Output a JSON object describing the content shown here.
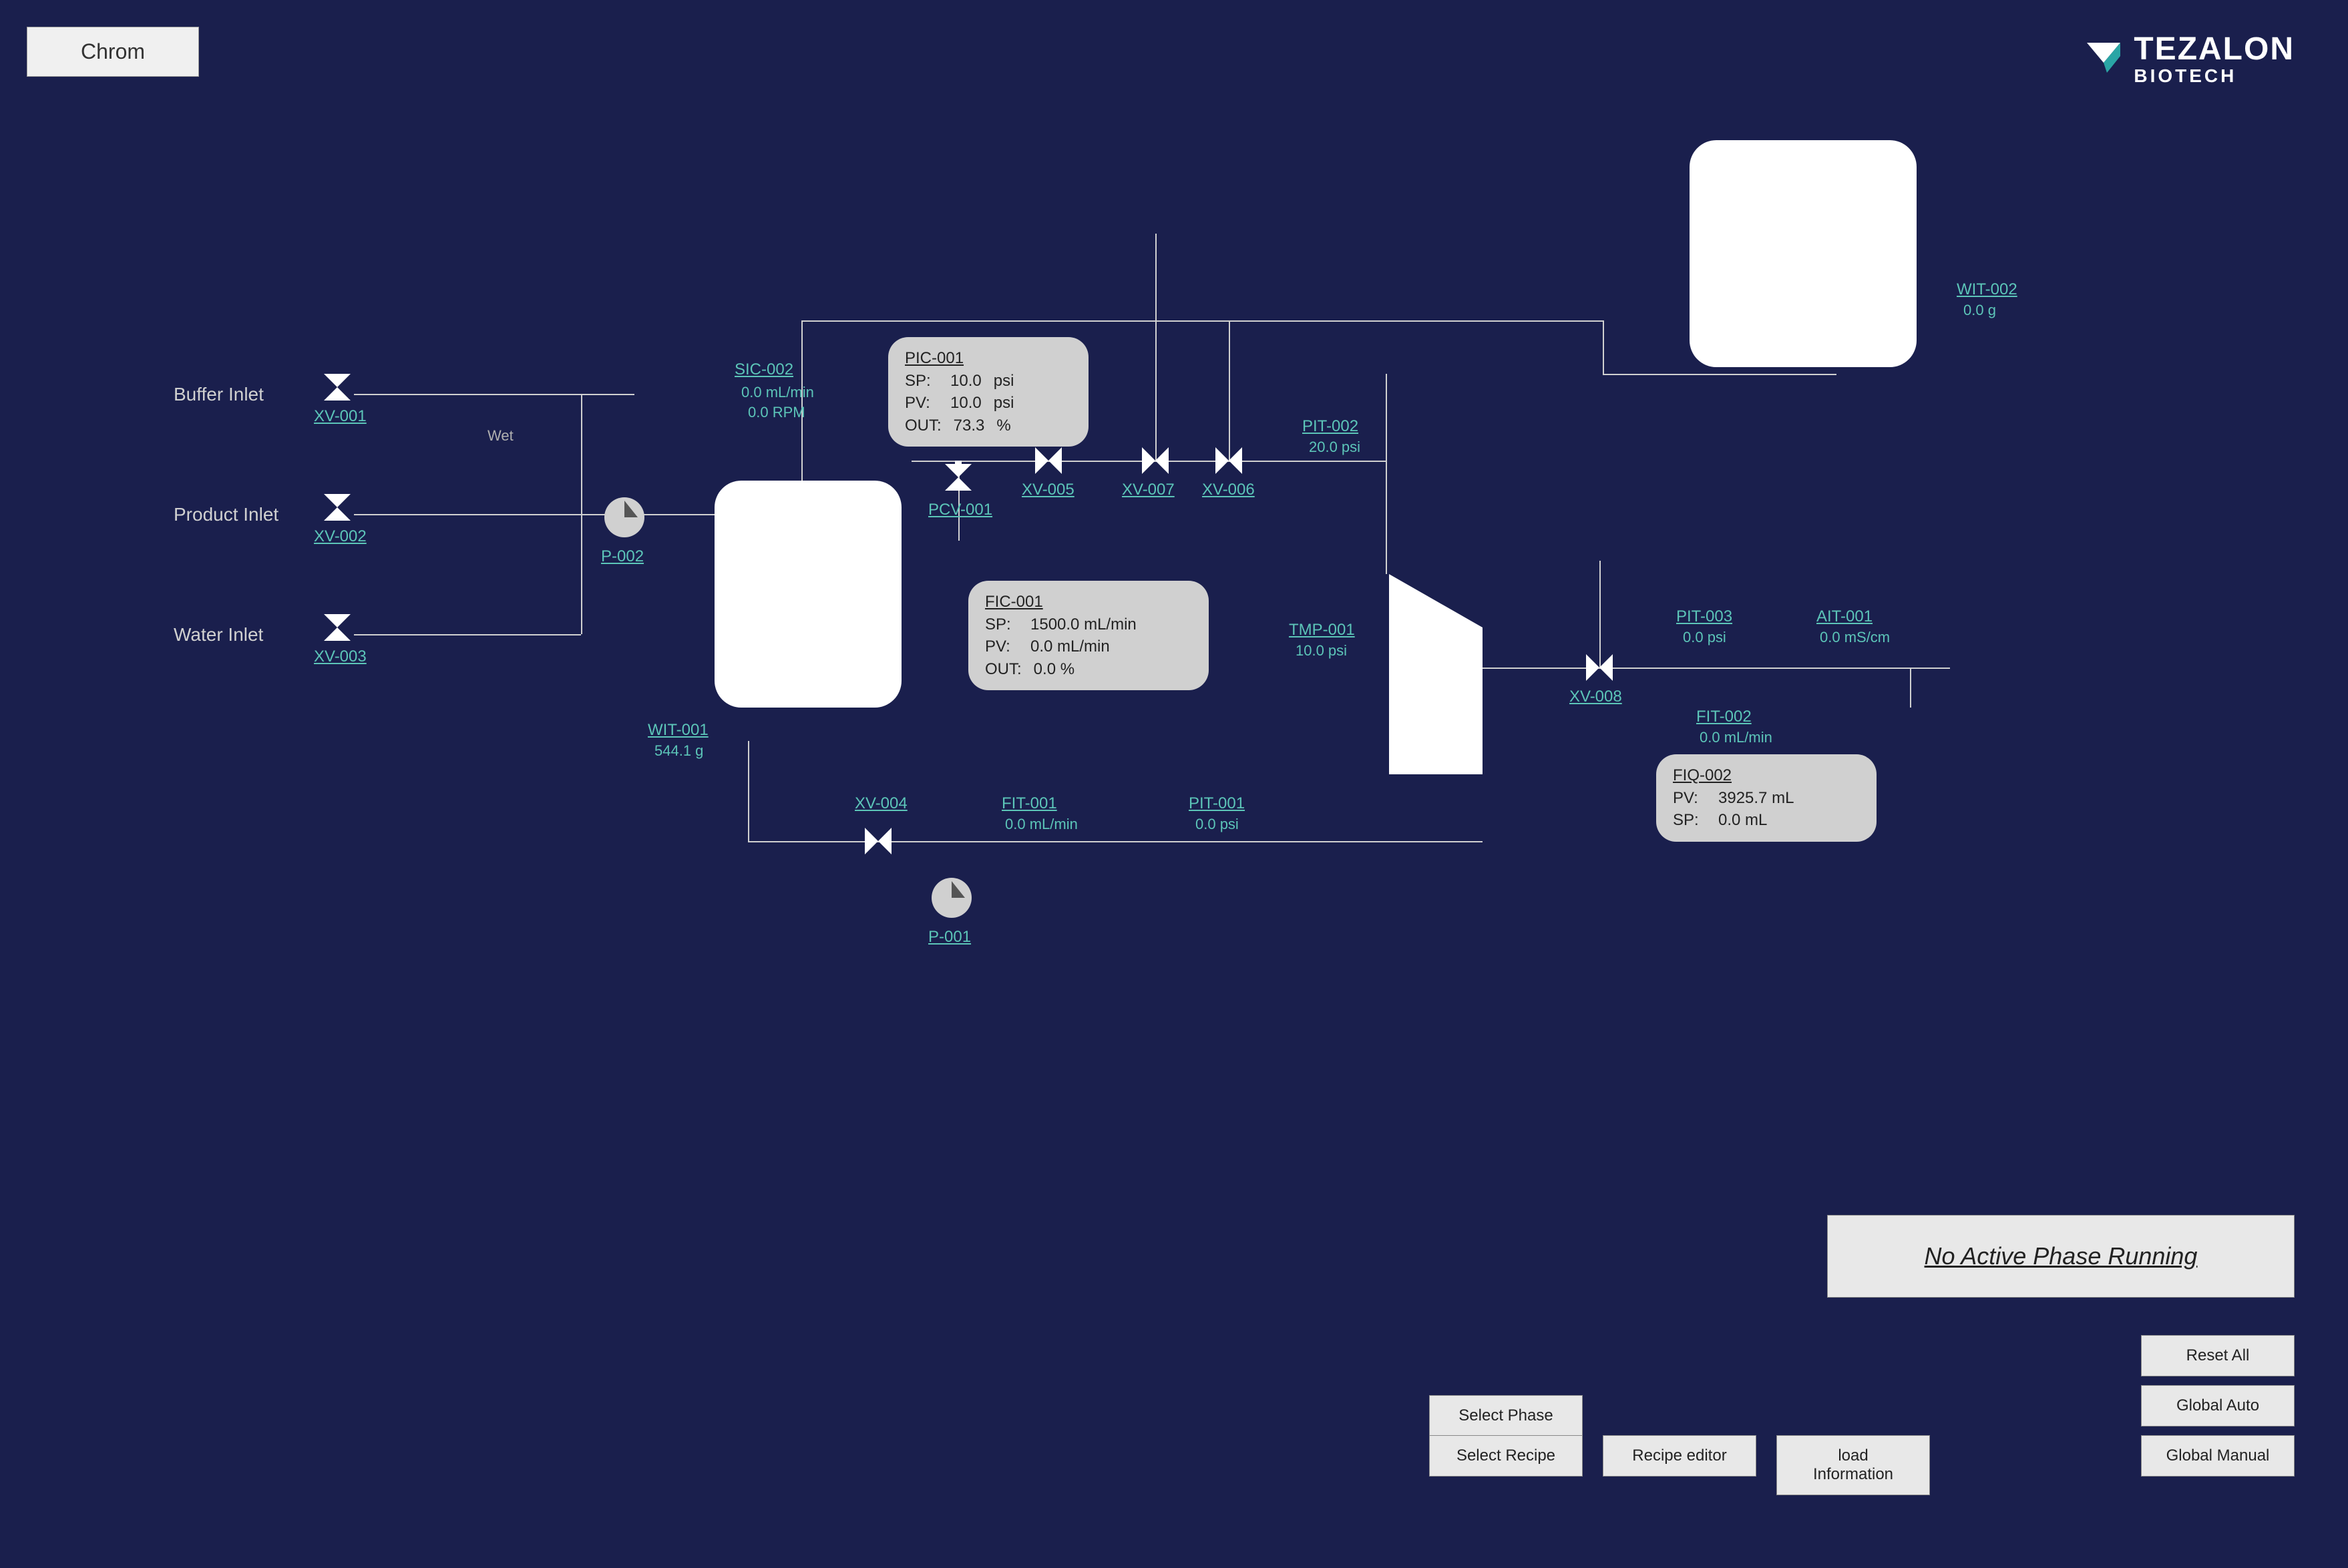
{
  "tab": "Chrom",
  "brand": {
    "name": "TEZALON",
    "sub": "BIOTECH"
  },
  "inlets": {
    "buffer": {
      "label": "Buffer Inlet",
      "valve": "XV-001"
    },
    "product": {
      "label": "Product Inlet",
      "valve": "XV-002"
    },
    "water": {
      "label": "Water Inlet",
      "valve": "XV-003"
    },
    "wet": "Wet"
  },
  "pumps": {
    "p002": "P-002",
    "p001": "P-001"
  },
  "sic002": {
    "tag": "SIC-002",
    "flow": "0.0 mL/min",
    "rpm": "0.0 RPM"
  },
  "wit001": {
    "tag": "WIT-001",
    "value": "544.1 g"
  },
  "wit002": {
    "tag": "WIT-002",
    "value": "0.0 g"
  },
  "pic001": {
    "title": "PIC-001",
    "sp": {
      "label": "SP:",
      "value": "10.0",
      "unit": "psi"
    },
    "pv": {
      "label": "PV:",
      "value": "10.0",
      "unit": "psi"
    },
    "out": {
      "label": "OUT:",
      "value": "73.3",
      "unit": "%"
    }
  },
  "pcv001": "PCV-001",
  "xv004": "XV-004",
  "xv005": "XV-005",
  "xv006": "XV-006",
  "xv007": "XV-007",
  "xv008": "XV-008",
  "fic001": {
    "title": "FIC-001",
    "sp": {
      "label": "SP:",
      "value": "1500.0 mL/min"
    },
    "pv": {
      "label": "PV:",
      "value": "0.0 mL/min"
    },
    "out": {
      "label": "OUT:",
      "value": "0.0 %"
    }
  },
  "fit001": {
    "tag": "FIT-001",
    "value": "0.0 mL/min"
  },
  "pit001": {
    "tag": "PIT-001",
    "value": "0.0 psi"
  },
  "pit002": {
    "tag": "PIT-002",
    "value": "20.0 psi"
  },
  "pit003": {
    "tag": "PIT-003",
    "value": "0.0 psi"
  },
  "tmp001": {
    "tag": "TMP-001",
    "value": "10.0 psi"
  },
  "ait001": {
    "tag": "AIT-001",
    "value": "0.0 mS/cm"
  },
  "fit002": {
    "tag": "FIT-002",
    "value": "0.0 mL/min"
  },
  "fiq002": {
    "title": "FIQ-002",
    "pv": {
      "label": "PV:",
      "value": "3925.7 mL"
    },
    "sp": {
      "label": "SP:",
      "value": "0.0 mL"
    }
  },
  "status": "No Active Phase Running",
  "buttons": {
    "reset": "Reset All",
    "globalAuto": "Global Auto",
    "globalManual": "Global Manual",
    "selectPhase": "Select Phase",
    "selectRecipe": "Select Recipe",
    "recipeEditor": "Recipe editor",
    "loadInfo": "load Information"
  }
}
